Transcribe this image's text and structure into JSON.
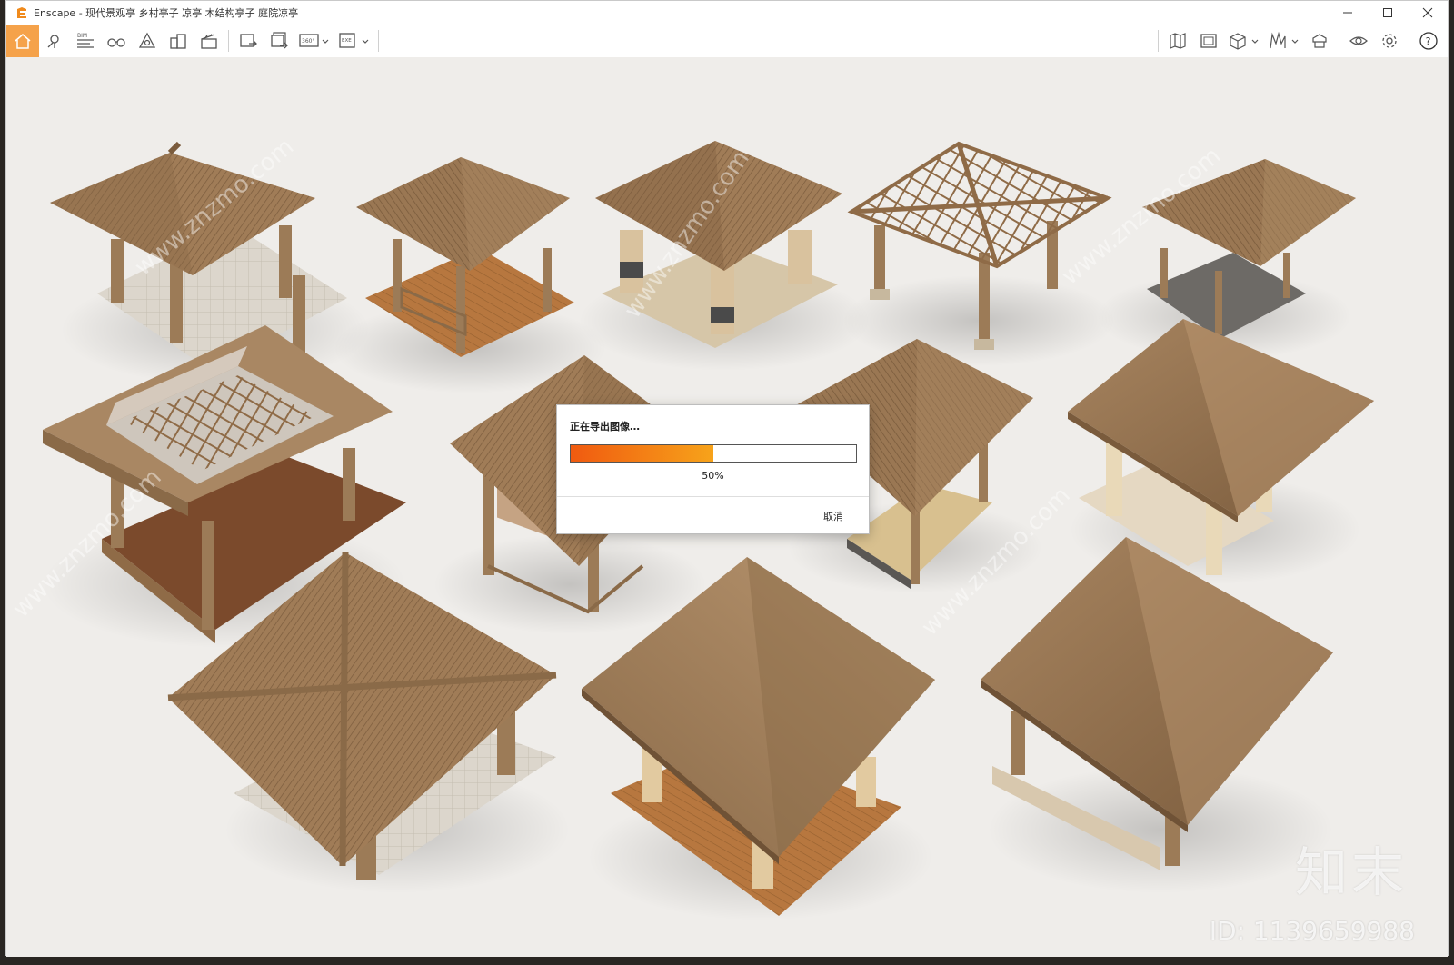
{
  "app": {
    "title": "Enscape - 现代景观亭 乡村亭子 凉亭 木结构亭子 庭院凉亭",
    "brand_color": "#f08a1c"
  },
  "window_controls": [
    {
      "name": "minimize",
      "glyph": "—"
    },
    {
      "name": "maximize",
      "glyph": "☐"
    },
    {
      "name": "close",
      "glyph": "✕"
    }
  ],
  "toolbar": {
    "left_icons": [
      "home-icon",
      "location-icon",
      "bim-icon",
      "binoculars-icon",
      "vr-headset-icon",
      "buildings-icon",
      "clapperboard-icon",
      "screenshot-export-icon",
      "batch-export-icon",
      "panorama-360-icon",
      "exe-export-icon"
    ],
    "bim_label": "BIM",
    "pano_label": "360°",
    "exe_label": "EXE",
    "right_icons": [
      "map-icon",
      "image-frame-icon",
      "cube-asset-icon",
      "material-library-icon",
      "atmosphere-icon",
      "visibility-eye-icon",
      "settings-gear-icon",
      "help-icon"
    ],
    "help_glyph": "?"
  },
  "dialog": {
    "title": "正在导出图像…",
    "progress": 0.5,
    "progress_label": "50%",
    "cancel_label": "取消",
    "fill_start": "#f05a10",
    "fill_end": "#f7a31a"
  },
  "watermarks": {
    "diagonal_text": "www.znzmo.com",
    "logo": "知末",
    "id_text": "ID: 1139659988"
  },
  "scene": {
    "background": "#efedea",
    "roof_dark": "#8a6a48",
    "roof_light": "#b08d66",
    "column": "#9c7b57",
    "stone_base": "#d8cdbd",
    "deck_wood": "#b7773f",
    "cream_column": "#e9d9b8"
  }
}
